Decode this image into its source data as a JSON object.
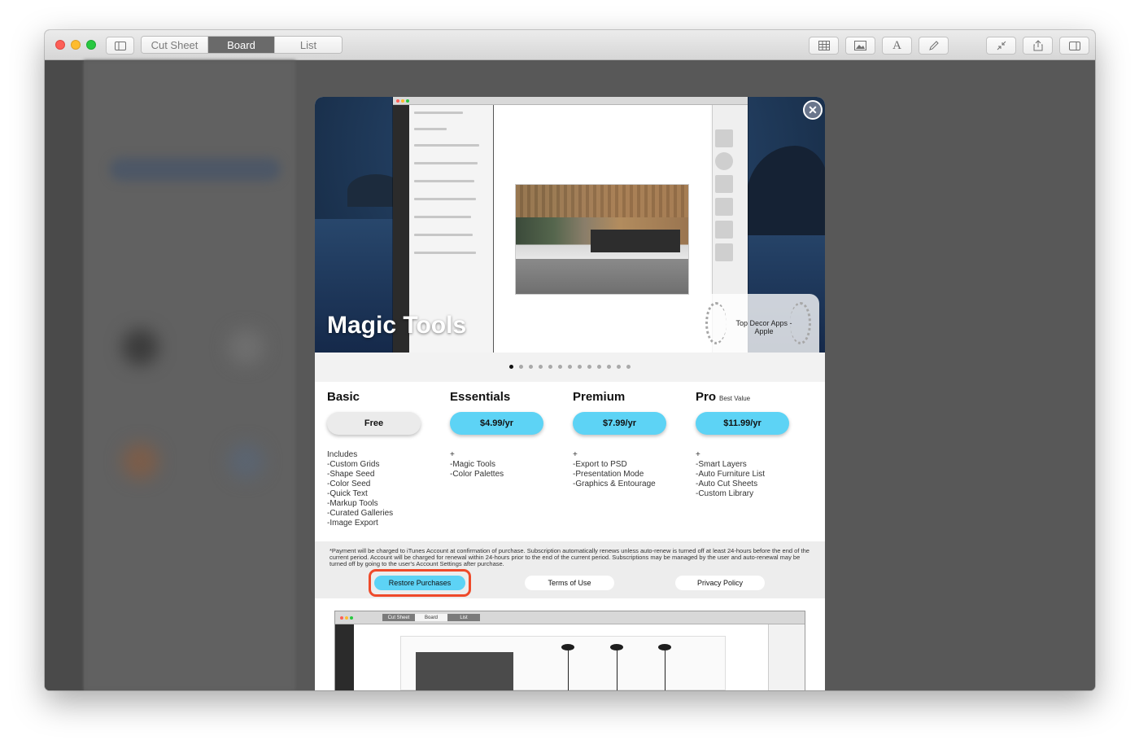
{
  "toolbar": {
    "tabs": [
      {
        "label": "Cut Sheet",
        "active": false
      },
      {
        "label": "Board",
        "active": true
      },
      {
        "label": "List",
        "active": false
      }
    ]
  },
  "hero": {
    "title": "Magic Tools",
    "badge_text": "Top Decor Apps -Apple",
    "slides_total": 13,
    "slide_active": 1
  },
  "plans": [
    {
      "name": "Basic",
      "tag": "",
      "price": "Free",
      "features": [
        "Includes",
        "-Custom Grids",
        "-Shape Seed",
        "-Color Seed",
        "-Quick Text",
        "-Markup Tools",
        "-Curated Galleries",
        "-Image Export"
      ]
    },
    {
      "name": "Essentials",
      "tag": "",
      "price": "$4.99/yr",
      "features": [
        "+",
        "-Magic Tools",
        "-Color Palettes"
      ]
    },
    {
      "name": "Premium",
      "tag": "",
      "price": "$7.99/yr",
      "features": [
        "+",
        "-Export to PSD",
        "-Presentation Mode",
        "-Graphics & Entourage"
      ]
    },
    {
      "name": "Pro",
      "tag": "Best Value",
      "price": "$11.99/yr",
      "features": [
        "+",
        "-Smart Layers",
        "-Auto Furniture List",
        "-Auto Cut Sheets",
        "-Custom Library"
      ]
    }
  ],
  "legal": {
    "fine_print": "*Payment will be charged to iTunes Account at confirmation of purchase. Subscription automatically renews unless auto-renew is turned off at least 24-hours before the end of the current period. Account will be charged for renewal within 24-hours prior to the end of the current period. Subscriptions may be managed by the user and auto-renewal may be turned off by going to the user's Account Settings after purchase.",
    "restore_label": "Restore Purchases",
    "terms_label": "Terms of Use",
    "privacy_label": "Privacy Policy"
  },
  "preview": {
    "tabs": [
      "Cut Sheet",
      "Board",
      "List"
    ]
  },
  "colors": {
    "accent": "#5dd3f5",
    "highlight": "#ef4a2a"
  }
}
